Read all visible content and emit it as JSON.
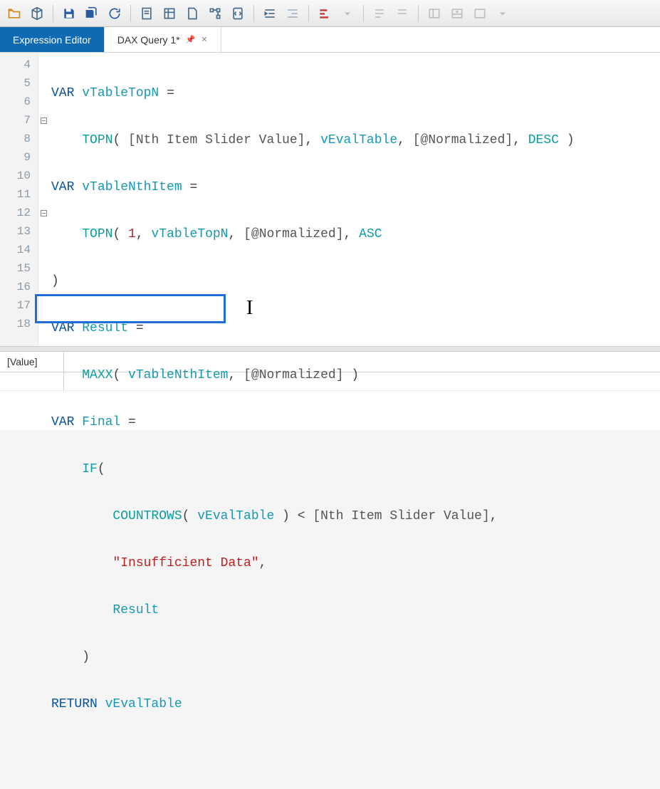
{
  "tabs": {
    "expression_editor": "Expression Editor",
    "dax_query": "DAX Query 1*"
  },
  "code": {
    "l4": {
      "var": "VAR",
      "name": "vTableTopN",
      "eq": "="
    },
    "l5": {
      "fn": "TOPN",
      "arg1": "[Nth Item Slider Value]",
      "arg2": "vEvalTable",
      "arg3": "[@Normalized]",
      "order": "DESC"
    },
    "l6": {
      "var": "VAR",
      "name": "vTableNthItem",
      "eq": "="
    },
    "l7": {
      "fn": "TOPN",
      "num": "1",
      "arg2": "vTableTopN",
      "arg3": "[@Normalized]",
      "order": "ASC"
    },
    "l8": {
      "paren": ")"
    },
    "l9": {
      "var": "VAR",
      "name": "Result",
      "eq": "="
    },
    "l10": {
      "fn": "MAXX",
      "arg1": "vTableNthItem",
      "arg2": "[@Normalized]"
    },
    "l11": {
      "var": "VAR",
      "name": "Final",
      "eq": "="
    },
    "l12": {
      "fn": "IF",
      "open": "("
    },
    "l13": {
      "fn": "COUNTROWS",
      "arg": "vEvalTable",
      "op": "<",
      "rhs": "[Nth Item Slider Value]"
    },
    "l14": {
      "str": "\"Insufficient Data\""
    },
    "l15": {
      "name": "Result"
    },
    "l16": {
      "paren": ")"
    },
    "l17": {
      "ret": "RETURN",
      "expr": "vEvalTable"
    }
  },
  "gutter": [
    "4",
    "5",
    "6",
    "7",
    "8",
    "9",
    "10",
    "11",
    "12",
    "13",
    "14",
    "15",
    "16",
    "17",
    "18"
  ],
  "results": {
    "columns": [
      "[Value]"
    ]
  }
}
